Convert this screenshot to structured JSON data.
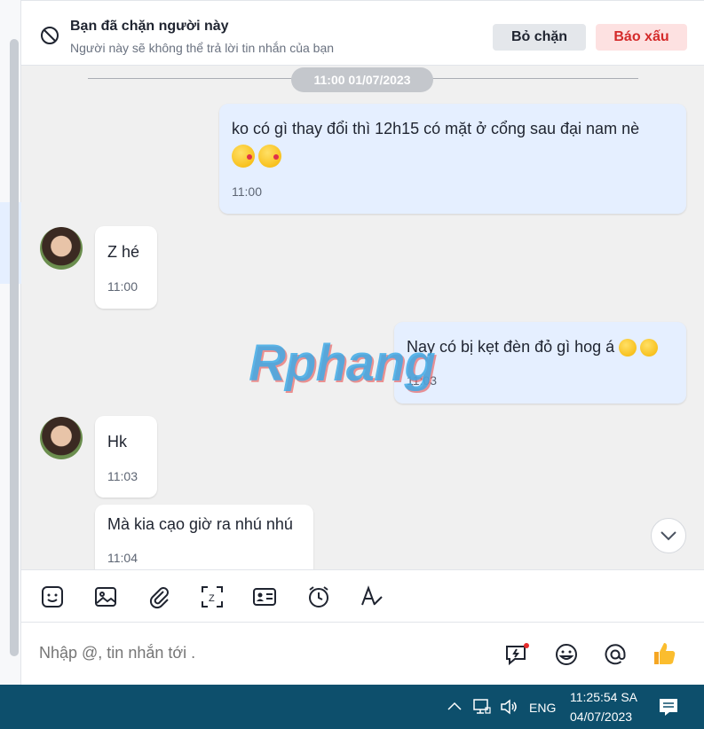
{
  "banner": {
    "title": "Bạn đã chặn người này",
    "subtitle": "Người này sẽ không thể trả lời tin nhắn của bạn",
    "unblock_label": "Bỏ chặn",
    "report_label": "Báo xấu"
  },
  "chat": {
    "date_separator": "11:00 01/07/2023",
    "watermark": "Rphang",
    "messages": [
      {
        "sender": "me",
        "text": "ko có gì thay đổi thì 12h15 có mặt ở cổng sau đại nam nè",
        "emoji_line": "😘😘",
        "time": "11:00"
      },
      {
        "sender": "them",
        "text": "Z hé",
        "time": "11:00"
      },
      {
        "sender": "me",
        "text": "Nay có bị kẹt đèn đỏ gì hog á",
        "emoji_line": "🤣🤣",
        "time": "11:03"
      },
      {
        "sender": "them",
        "text": "Hk",
        "time": "11:03"
      },
      {
        "sender": "them",
        "text": "Mà kia cạo giờ ra nhú nhú",
        "time": "11:04"
      }
    ]
  },
  "toolbar": {
    "icons": [
      "sticker-icon",
      "image-icon",
      "attachment-icon",
      "screenshot-icon",
      "contact-card-icon",
      "reminder-icon",
      "text-format-icon"
    ]
  },
  "composer": {
    "placeholder": "Nhập @, tin nhắn tới .",
    "icons": [
      "quick-message-icon",
      "emoji-icon",
      "mention-icon",
      "like-icon"
    ]
  },
  "taskbar": {
    "language": "ENG",
    "time": "11:25:54 SA",
    "date": "04/07/2023"
  },
  "colors": {
    "accent": "#0068ff",
    "my_bubble": "#e5efff",
    "their_bubble": "#ffffff",
    "report_text": "#d42a2a",
    "taskbar": "#0d4f6c"
  }
}
